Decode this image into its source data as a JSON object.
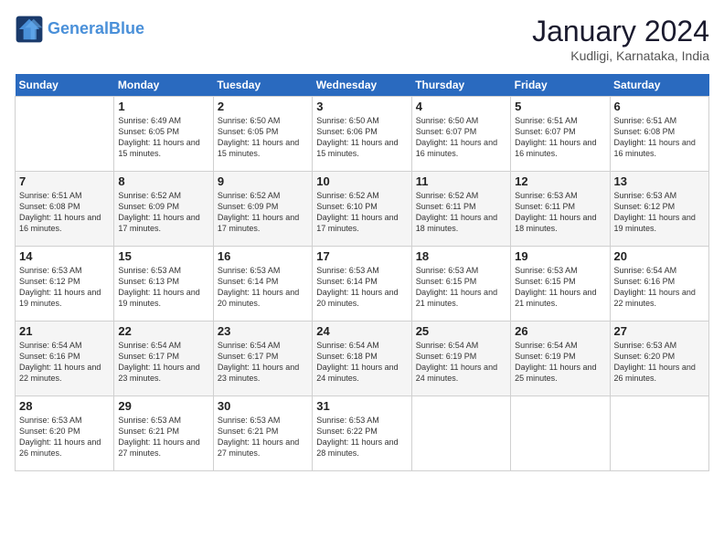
{
  "header": {
    "logo_text_general": "General",
    "logo_text_blue": "Blue",
    "month": "January 2024",
    "location": "Kudligi, Karnataka, India"
  },
  "days_of_week": [
    "Sunday",
    "Monday",
    "Tuesday",
    "Wednesday",
    "Thursday",
    "Friday",
    "Saturday"
  ],
  "weeks": [
    [
      {
        "day": "",
        "info": ""
      },
      {
        "day": "1",
        "info": "Sunrise: 6:49 AM\nSunset: 6:05 PM\nDaylight: 11 hours\nand 15 minutes."
      },
      {
        "day": "2",
        "info": "Sunrise: 6:50 AM\nSunset: 6:05 PM\nDaylight: 11 hours\nand 15 minutes."
      },
      {
        "day": "3",
        "info": "Sunrise: 6:50 AM\nSunset: 6:06 PM\nDaylight: 11 hours\nand 15 minutes."
      },
      {
        "day": "4",
        "info": "Sunrise: 6:50 AM\nSunset: 6:07 PM\nDaylight: 11 hours\nand 16 minutes."
      },
      {
        "day": "5",
        "info": "Sunrise: 6:51 AM\nSunset: 6:07 PM\nDaylight: 11 hours\nand 16 minutes."
      },
      {
        "day": "6",
        "info": "Sunrise: 6:51 AM\nSunset: 6:08 PM\nDaylight: 11 hours\nand 16 minutes."
      }
    ],
    [
      {
        "day": "7",
        "info": "Sunrise: 6:51 AM\nSunset: 6:08 PM\nDaylight: 11 hours\nand 16 minutes."
      },
      {
        "day": "8",
        "info": "Sunrise: 6:52 AM\nSunset: 6:09 PM\nDaylight: 11 hours\nand 17 minutes."
      },
      {
        "day": "9",
        "info": "Sunrise: 6:52 AM\nSunset: 6:09 PM\nDaylight: 11 hours\nand 17 minutes."
      },
      {
        "day": "10",
        "info": "Sunrise: 6:52 AM\nSunset: 6:10 PM\nDaylight: 11 hours\nand 17 minutes."
      },
      {
        "day": "11",
        "info": "Sunrise: 6:52 AM\nSunset: 6:11 PM\nDaylight: 11 hours\nand 18 minutes."
      },
      {
        "day": "12",
        "info": "Sunrise: 6:53 AM\nSunset: 6:11 PM\nDaylight: 11 hours\nand 18 minutes."
      },
      {
        "day": "13",
        "info": "Sunrise: 6:53 AM\nSunset: 6:12 PM\nDaylight: 11 hours\nand 19 minutes."
      }
    ],
    [
      {
        "day": "14",
        "info": "Sunrise: 6:53 AM\nSunset: 6:12 PM\nDaylight: 11 hours\nand 19 minutes."
      },
      {
        "day": "15",
        "info": "Sunrise: 6:53 AM\nSunset: 6:13 PM\nDaylight: 11 hours\nand 19 minutes."
      },
      {
        "day": "16",
        "info": "Sunrise: 6:53 AM\nSunset: 6:14 PM\nDaylight: 11 hours\nand 20 minutes."
      },
      {
        "day": "17",
        "info": "Sunrise: 6:53 AM\nSunset: 6:14 PM\nDaylight: 11 hours\nand 20 minutes."
      },
      {
        "day": "18",
        "info": "Sunrise: 6:53 AM\nSunset: 6:15 PM\nDaylight: 11 hours\nand 21 minutes."
      },
      {
        "day": "19",
        "info": "Sunrise: 6:53 AM\nSunset: 6:15 PM\nDaylight: 11 hours\nand 21 minutes."
      },
      {
        "day": "20",
        "info": "Sunrise: 6:54 AM\nSunset: 6:16 PM\nDaylight: 11 hours\nand 22 minutes."
      }
    ],
    [
      {
        "day": "21",
        "info": "Sunrise: 6:54 AM\nSunset: 6:16 PM\nDaylight: 11 hours\nand 22 minutes."
      },
      {
        "day": "22",
        "info": "Sunrise: 6:54 AM\nSunset: 6:17 PM\nDaylight: 11 hours\nand 23 minutes."
      },
      {
        "day": "23",
        "info": "Sunrise: 6:54 AM\nSunset: 6:17 PM\nDaylight: 11 hours\nand 23 minutes."
      },
      {
        "day": "24",
        "info": "Sunrise: 6:54 AM\nSunset: 6:18 PM\nDaylight: 11 hours\nand 24 minutes."
      },
      {
        "day": "25",
        "info": "Sunrise: 6:54 AM\nSunset: 6:19 PM\nDaylight: 11 hours\nand 24 minutes."
      },
      {
        "day": "26",
        "info": "Sunrise: 6:54 AM\nSunset: 6:19 PM\nDaylight: 11 hours\nand 25 minutes."
      },
      {
        "day": "27",
        "info": "Sunrise: 6:53 AM\nSunset: 6:20 PM\nDaylight: 11 hours\nand 26 minutes."
      }
    ],
    [
      {
        "day": "28",
        "info": "Sunrise: 6:53 AM\nSunset: 6:20 PM\nDaylight: 11 hours\nand 26 minutes."
      },
      {
        "day": "29",
        "info": "Sunrise: 6:53 AM\nSunset: 6:21 PM\nDaylight: 11 hours\nand 27 minutes."
      },
      {
        "day": "30",
        "info": "Sunrise: 6:53 AM\nSunset: 6:21 PM\nDaylight: 11 hours\nand 27 minutes."
      },
      {
        "day": "31",
        "info": "Sunrise: 6:53 AM\nSunset: 6:22 PM\nDaylight: 11 hours\nand 28 minutes."
      },
      {
        "day": "",
        "info": ""
      },
      {
        "day": "",
        "info": ""
      },
      {
        "day": "",
        "info": ""
      }
    ]
  ]
}
